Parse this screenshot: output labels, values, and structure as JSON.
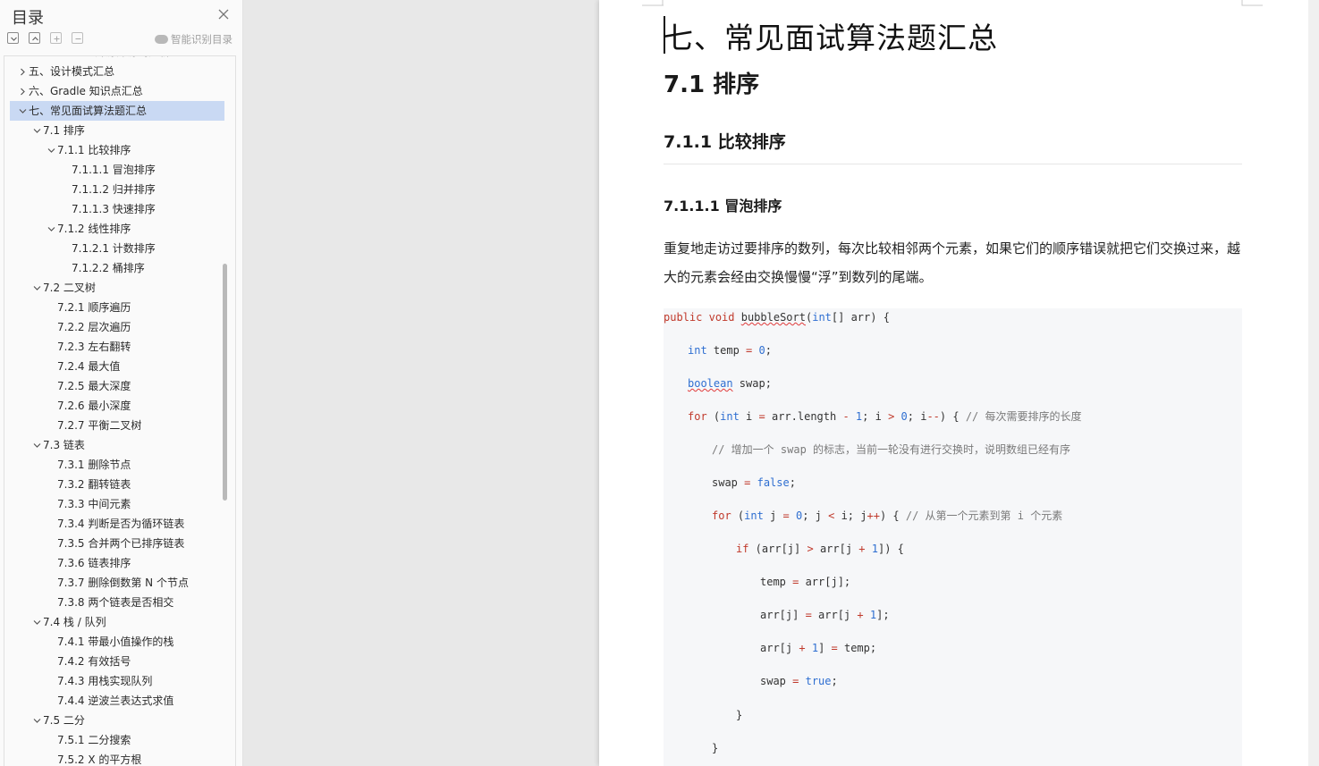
{
  "toc": {
    "title": "目录",
    "smart_label": "智能识别目录",
    "items": [
      {
        "label": "四、Android 开源库源码分析",
        "level": 0,
        "expanded": false
      },
      {
        "label": "五、设计模式汇总",
        "level": 0,
        "expanded": false
      },
      {
        "label": "六、Gradle 知识点汇总",
        "level": 0,
        "expanded": false
      },
      {
        "label": "七、常见面试算法题汇总",
        "level": 0,
        "expanded": true,
        "selected": true
      },
      {
        "label": "7.1  排序",
        "level": 1,
        "expanded": true
      },
      {
        "label": "7.1.1  比较排序",
        "level": 2,
        "expanded": true
      },
      {
        "label": "7.1.1.1  冒泡排序",
        "level": 3
      },
      {
        "label": "7.1.1.2  归并排序",
        "level": 3
      },
      {
        "label": "7.1.1.3  快速排序",
        "level": 3
      },
      {
        "label": "7.1.2  线性排序",
        "level": 2,
        "expanded": true
      },
      {
        "label": "7.1.2.1  计数排序",
        "level": 3
      },
      {
        "label": "7.1.2.2  桶排序",
        "level": 3
      },
      {
        "label": "7.2  二叉树",
        "level": 1,
        "expanded": true
      },
      {
        "label": "7.2.1  顺序遍历",
        "level": 2
      },
      {
        "label": "7.2.2  层次遍历",
        "level": 2
      },
      {
        "label": "7.2.3  左右翻转",
        "level": 2
      },
      {
        "label": "7.2.4  最大值",
        "level": 2
      },
      {
        "label": "7.2.5  最大深度",
        "level": 2
      },
      {
        "label": "7.2.6  最小深度",
        "level": 2
      },
      {
        "label": "7.2.7  平衡二叉树",
        "level": 2
      },
      {
        "label": "7.3  链表",
        "level": 1,
        "expanded": true
      },
      {
        "label": "7.3.1  删除节点",
        "level": 2
      },
      {
        "label": "7.3.2  翻转链表",
        "level": 2
      },
      {
        "label": "7.3.3  中间元素",
        "level": 2
      },
      {
        "label": "7.3.4  判断是否为循环链表",
        "level": 2
      },
      {
        "label": "7.3.5  合并两个已排序链表",
        "level": 2
      },
      {
        "label": "7.3.6  链表排序",
        "level": 2
      },
      {
        "label": "7.3.7  删除倒数第 N 个节点",
        "level": 2
      },
      {
        "label": "7.3.8  两个链表是否相交",
        "level": 2
      },
      {
        "label": "7.4  栈 / 队列",
        "level": 1,
        "expanded": true
      },
      {
        "label": "7.4.1  带最小值操作的栈",
        "level": 2
      },
      {
        "label": "7.4.2  有效括号",
        "level": 2
      },
      {
        "label": "7.4.3  用栈实现队列",
        "level": 2
      },
      {
        "label": "7.4.4  逆波兰表达式求值",
        "level": 2
      },
      {
        "label": "7.5  二分",
        "level": 1,
        "expanded": true
      },
      {
        "label": "7.5.1  二分搜索",
        "level": 2
      },
      {
        "label": "7.5.2  X 的平方根",
        "level": 2
      }
    ]
  },
  "doc": {
    "h1": "七、常见面试算法题汇总",
    "h2": "7.1  排序",
    "h3": "7.1.1  比较排序",
    "h4": "7.1.1.1  冒泡排序",
    "paragraph": "重复地走访过要排序的数列，每次比较相邻两个元素，如果它们的顺序错误就把它们交换过来，越大的元素会经由交换慢慢“浮”到数列的尾端。",
    "code": {
      "l1_kw1": "public",
      "l1_kw2": "void",
      "l1_fn": "bubbleSort",
      "l1_paren": "(",
      "l1_ty": "int",
      "l1_rest": "[] arr) {",
      "l2_ty": "int",
      "l2_a": " temp ",
      "l2_op": "=",
      "l2_sp": " ",
      "l2_num": "0",
      "l2_end": ";",
      "l3_ty": "boolean",
      "l3_rest": " swap;",
      "l4_kw": "for",
      "l4_a": " (",
      "l4_ty": "int",
      "l4_b": " i ",
      "l4_op1": "=",
      "l4_c": " arr.length ",
      "l4_op2": "-",
      "l4_sp1": " ",
      "l4_num1": "1",
      "l4_d": "; i ",
      "l4_op3": ">",
      "l4_sp2": " ",
      "l4_num2": "0",
      "l4_e": "; i",
      "l4_op4": "--",
      "l4_f": ") { ",
      "l4_cm": "// 每次需要排序的长度",
      "l5_cm": "// 增加一个 swap 的标志，当前一轮没有进行交换时，说明数组已经有序",
      "l6_a": "swap ",
      "l6_op": "=",
      "l6_sp": " ",
      "l6_kw": "false",
      "l6_end": ";",
      "l7_kw": "for",
      "l7_a": " (",
      "l7_ty": "int",
      "l7_b": " j ",
      "l7_op1": "=",
      "l7_sp1": " ",
      "l7_num": "0",
      "l7_c": "; j ",
      "l7_op2": "<",
      "l7_d": " i; j",
      "l7_op3": "++",
      "l7_e": ") { ",
      "l7_cm": "// 从第一个元素到第 i 个元素",
      "l8_kw": "if",
      "l8_a": " (arr[j] ",
      "l8_op1": ">",
      "l8_b": " arr[j ",
      "l8_op2": "+",
      "l8_sp": " ",
      "l8_num": "1",
      "l8_c": "]) {",
      "l9_a": "temp ",
      "l9_op": "=",
      "l9_b": " arr[j];",
      "l10_a": "arr[j] ",
      "l10_op1": "=",
      "l10_b": " arr[j ",
      "l10_op2": "+",
      "l10_sp": " ",
      "l10_num": "1",
      "l10_c": "];",
      "l11_a": "arr[j ",
      "l11_op1": "+",
      "l11_sp": " ",
      "l11_num": "1",
      "l11_b": "] ",
      "l11_op2": "=",
      "l11_c": " temp;",
      "l12_a": "swap ",
      "l12_op": "=",
      "l12_sp": " ",
      "l12_kw": "true",
      "l12_end": ";",
      "l13": "}",
      "l14": "}"
    }
  },
  "colors": {
    "selection": "#c9d9f3",
    "keyword": "#c0392b",
    "type": "#2f6fd1",
    "comment": "#7a7a7a"
  }
}
